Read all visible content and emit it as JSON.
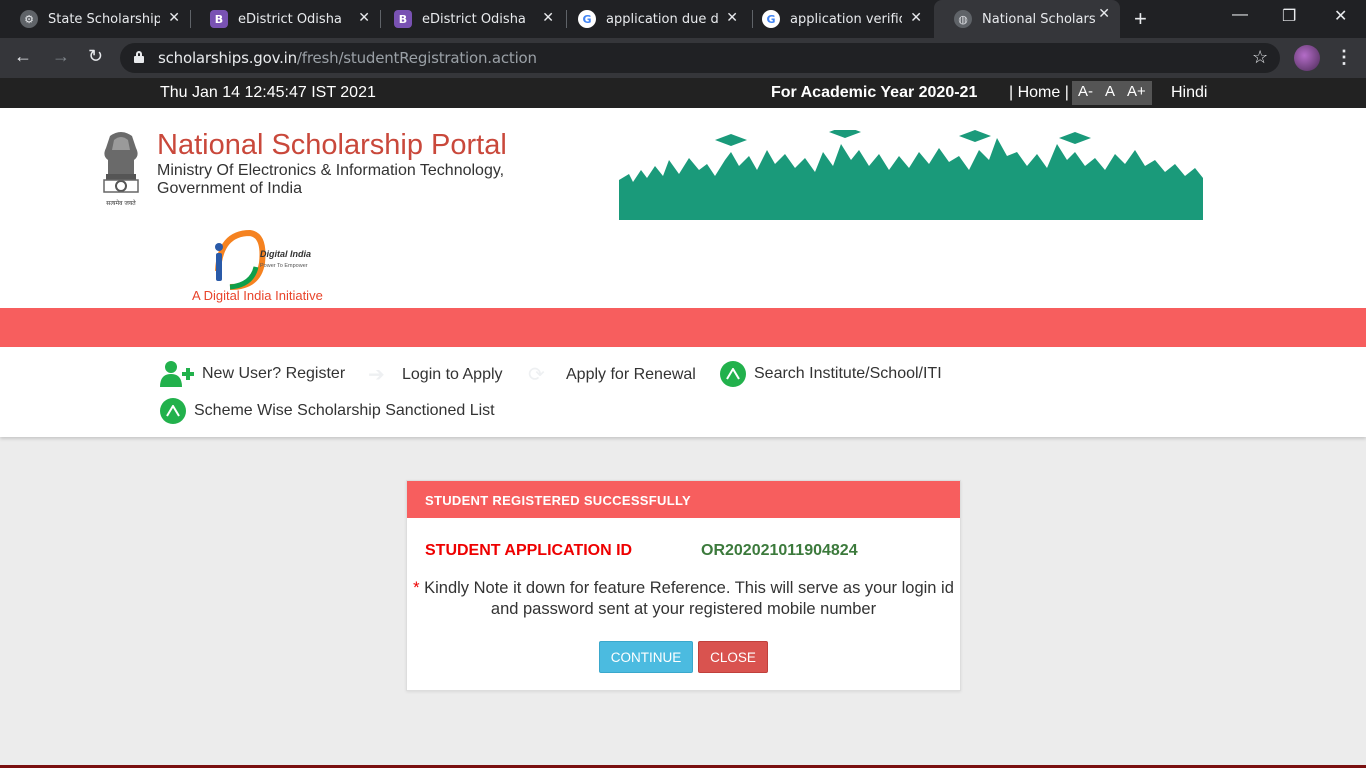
{
  "browser": {
    "tabs": [
      {
        "title": "State Scholarship P",
        "favicon": "gear-icon"
      },
      {
        "title": "eDistrict Odisha",
        "favicon": "bootstrap-icon",
        "letter": "B"
      },
      {
        "title": "eDistrict Odisha",
        "favicon": "bootstrap-icon",
        "letter": "B"
      },
      {
        "title": "application due dat",
        "favicon": "google-icon",
        "letter": "G"
      },
      {
        "title": "application verificat",
        "favicon": "google-icon",
        "letter": "G"
      },
      {
        "title": "National Scholarshi",
        "favicon": "globe-icon",
        "active": true
      }
    ],
    "url_domain": "scholarships.gov.in",
    "url_path": "/fresh/studentRegistration.action"
  },
  "topstrip": {
    "datetime": "Thu Jan 14 12:45:47 IST 2021",
    "academic_year": "For Academic Year 2020-21",
    "home": "| Home |",
    "font_small": "A-",
    "font_normal": "A",
    "font_large": "A+",
    "language": "Hindi"
  },
  "header": {
    "title": "National Scholarship Portal",
    "ministry_line1": "Ministry Of Electronics & Information Technology,",
    "ministry_line2": "Government of India",
    "emblem_caption": "सत्यमेव जयते",
    "digital_india_label": "Digital India",
    "digital_india_tagline": "Power To Empower",
    "digital_india_initiative": "A Digital India Initiative"
  },
  "menu": {
    "register": "New User? Register",
    "login": "Login to Apply",
    "renewal": "Apply for Renewal",
    "search_institute": "Search Institute/School/ITI",
    "sanctioned_list": "Scheme Wise Scholarship Sanctioned List"
  },
  "modal": {
    "heading": "STUDENT REGISTERED SUCCESSFULLY",
    "app_id_label": "STUDENT APPLICATION ID",
    "app_id_value": "OR202021011904824",
    "note_asterisk": "*",
    "note_text": "Kindly Note it down for feature Reference. This will serve as your login id and password sent at your registered mobile number",
    "continue_label": "CONTINUE",
    "close_label": "CLOSE"
  },
  "colors": {
    "accent_red": "#f75e5e",
    "title_red": "#c9483b",
    "banner_green": "#1a9a7a",
    "success_green": "#3c7a3c",
    "continue_blue": "#4bbbe0",
    "close_red": "#d9534f"
  }
}
